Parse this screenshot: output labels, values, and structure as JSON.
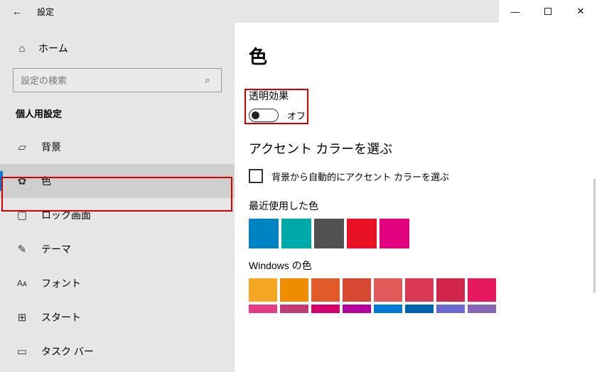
{
  "titlebar": {
    "title": "設定"
  },
  "sidebar": {
    "home": "ホーム",
    "search_placeholder": "設定の検索",
    "category": "個人用設定",
    "items": [
      {
        "label": "背景"
      },
      {
        "label": "色"
      },
      {
        "label": "ロック画面"
      },
      {
        "label": "テーマ"
      },
      {
        "label": "フォント"
      },
      {
        "label": "スタート"
      },
      {
        "label": "タスク バー"
      }
    ]
  },
  "page": {
    "title": "色",
    "transparency_label": "透明効果",
    "toggle_state": "オフ",
    "accent_heading": "アクセント カラーを選ぶ",
    "auto_checkbox": "背景から自動的にアクセント カラーを選ぶ",
    "recent_label": "最近使用した色",
    "recent_colors": [
      "#0083c2",
      "#00a9a9",
      "#515151",
      "#e81224",
      "#e3007f"
    ],
    "windows_label": "Windows の色",
    "windows_row1": [
      "#f5a623",
      "#ef8c00",
      "#e15a2a",
      "#d64831",
      "#e05a5a",
      "#d83a56",
      "#d1254a",
      "#e6185f"
    ],
    "windows_row2": [
      "#e73b86",
      "#c23a75",
      "#d6006c",
      "#b4009e",
      "#0078d7",
      "#0063b1",
      "#6b69d6",
      "#8764b8"
    ]
  }
}
